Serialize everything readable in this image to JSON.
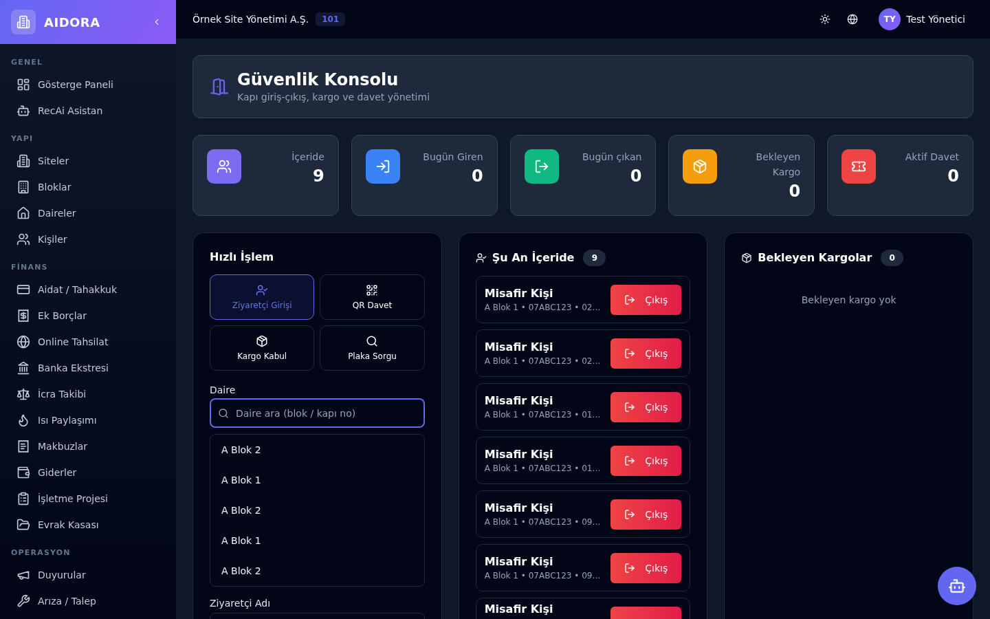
{
  "sidebar": {
    "brand": "AIDORA",
    "sections": [
      {
        "title": "GENEL",
        "items": [
          {
            "label": "Gösterge Paneli",
            "selected": false
          },
          {
            "label": "RecAi Asistan",
            "selected": false
          }
        ]
      },
      {
        "title": "YAPI",
        "items": [
          {
            "label": "Siteler",
            "selected": false
          },
          {
            "label": "Bloklar",
            "selected": false
          },
          {
            "label": "Daireler",
            "selected": false
          },
          {
            "label": "Kişiler",
            "selected": false
          }
        ]
      },
      {
        "title": "FİNANS",
        "items": [
          {
            "label": "Aidat / Tahakkuk",
            "selected": false
          },
          {
            "label": "Ek Borçlar",
            "selected": false
          },
          {
            "label": "Online Tahsilat",
            "selected": false
          },
          {
            "label": "Banka Ekstresi",
            "selected": false
          },
          {
            "label": "İcra Takibi",
            "selected": false
          },
          {
            "label": "Isı Paylaşımı",
            "selected": false
          },
          {
            "label": "Makbuzlar",
            "selected": false
          },
          {
            "label": "Giderler",
            "selected": false
          },
          {
            "label": "İşletme Projesi",
            "selected": false
          },
          {
            "label": "Evrak Kasası",
            "selected": false
          }
        ]
      },
      {
        "title": "OPERASYON",
        "items": [
          {
            "label": "Duyurular",
            "selected": false
          },
          {
            "label": "Arıza / Talep",
            "selected": false
          }
        ]
      }
    ]
  },
  "topbar": {
    "organization": "Örnek Site Yönetimi A.Ş.",
    "unit_badge": "101",
    "user": {
      "initials": "TY",
      "name": "Test Yönetici"
    }
  },
  "header": {
    "title": "Güvenlik Konsolu",
    "subtitle": "Kapı giriş-çıkış, kargo ve davet yönetimi"
  },
  "stats": [
    {
      "label": "İçeride",
      "value": "9",
      "color": "#7c6cf2"
    },
    {
      "label": "Bugün Giren",
      "value": "0",
      "color": "#3b82f6"
    },
    {
      "label": "Bugün çıkan",
      "value": "0",
      "color": "#10b981"
    },
    {
      "label": "Bekleyen Kargo",
      "value": "0",
      "color": "#f59e0b"
    },
    {
      "label": "Aktif Davet",
      "value": "0",
      "color": "#ef4444"
    }
  ],
  "quick_panel": {
    "title": "Hızlı İşlem",
    "actions": [
      {
        "label": "Ziyaretçi Girişi",
        "selected": true
      },
      {
        "label": "QR Davet",
        "selected": false
      },
      {
        "label": "Kargo Kabul",
        "selected": false
      },
      {
        "label": "Plaka Sorgu",
        "selected": false
      }
    ],
    "apartment": {
      "label": "Daire",
      "placeholder": "Daire ara (blok / kapı no)",
      "focused": true,
      "options": [
        "A Blok 2",
        "A Blok 1",
        "A Blok 2",
        "A Blok 1",
        "A Blok 2"
      ]
    },
    "visitor_name": {
      "label": "Ziyaretçi Adı"
    }
  },
  "inside_panel": {
    "title": "Şu An İçeride",
    "count": "9",
    "visitors": [
      {
        "name": "Misafir Kişi",
        "detail": "A Blok 1 • 07ABC123 • 02…",
        "action": "Çıkış"
      },
      {
        "name": "Misafir Kişi",
        "detail": "A Blok 1 • 07ABC123 • 02…",
        "action": "Çıkış"
      },
      {
        "name": "Misafir Kişi",
        "detail": "A Blok 1 • 07ABC123 • 01…",
        "action": "Çıkış"
      },
      {
        "name": "Misafir Kişi",
        "detail": "A Blok 1 • 07ABC123 • 01…",
        "action": "Çıkış"
      },
      {
        "name": "Misafir Kişi",
        "detail": "A Blok 1 • 07ABC123 • 09…",
        "action": "Çıkış"
      },
      {
        "name": "Misafir Kişi",
        "detail": "A Blok 1 • 07ABC123 • 09…",
        "action": "Çıkış"
      },
      {
        "name": "Misafir Kişi"
      }
    ]
  },
  "cargo_panel": {
    "title": "Bekleyen Kargolar",
    "count": "0",
    "empty_text": "Bekleyen kargo yok"
  }
}
